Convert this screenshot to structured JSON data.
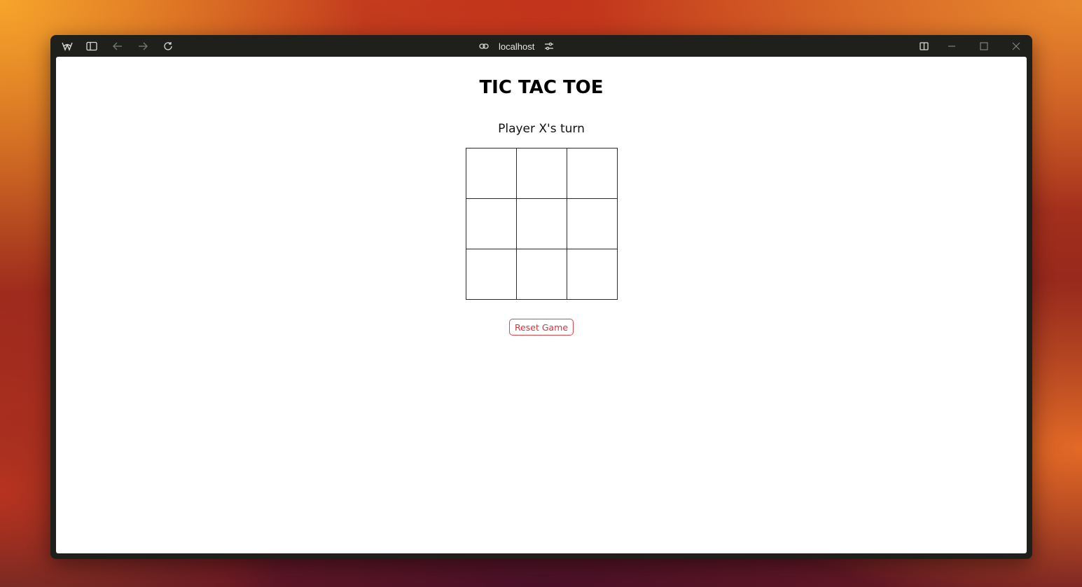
{
  "browser": {
    "address": "localhost",
    "icons": {
      "app": "browser-logo-icon",
      "sidebar": "sidebar-toggle-icon",
      "back": "back-arrow-icon",
      "forward": "forward-arrow-icon",
      "reload": "reload-icon",
      "link": "link-icon",
      "site_settings": "sliders-icon",
      "split_view": "split-view-icon",
      "minimize": "minimize-icon",
      "maximize": "maximize-icon",
      "close": "close-icon"
    }
  },
  "game": {
    "title": "TIC TAC TOE",
    "status": "Player X's turn",
    "board": [
      "",
      "",
      "",
      "",
      "",
      "",
      "",
      "",
      ""
    ],
    "reset_label": "Reset Game"
  },
  "colors": {
    "grid_line": "#1e2d3d",
    "reset_accent": "#d8323a",
    "window_chrome": "#1f1f1c"
  }
}
